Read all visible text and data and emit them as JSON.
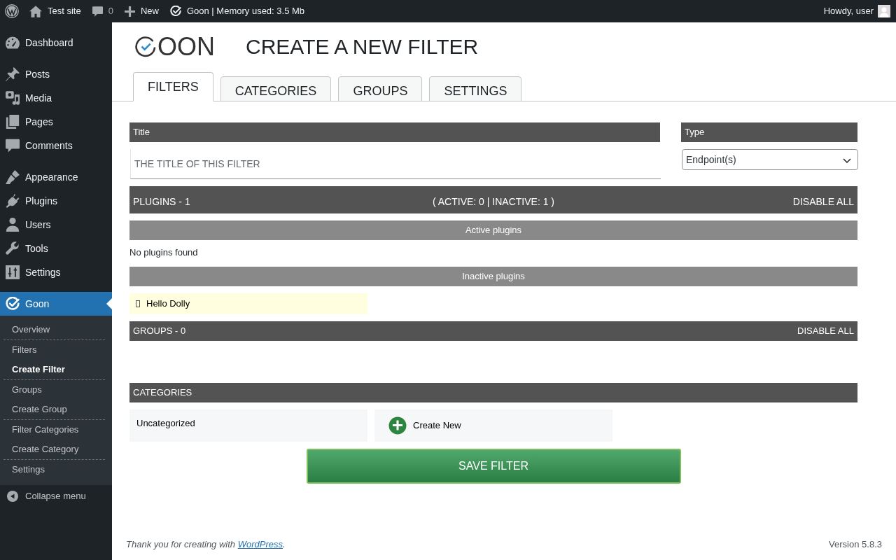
{
  "admin_bar": {
    "items": [
      {
        "kind": "home",
        "label": "Test site"
      },
      {
        "kind": "comments",
        "label": "0"
      },
      {
        "kind": "new",
        "label": "New"
      },
      {
        "kind": "goon",
        "label": "Goon | Memory used: 3.5 Mb"
      }
    ],
    "greeting": "Howdy, user"
  },
  "sidebar": {
    "menu_groups": [
      [
        {
          "kind": "dashboard",
          "label": "Dashboard",
          "selected": false
        }
      ],
      [
        {
          "kind": "posts",
          "label": "Posts",
          "selected": false
        },
        {
          "kind": "media",
          "label": "Media",
          "selected": false
        },
        {
          "kind": "pages",
          "label": "Pages",
          "selected": false
        },
        {
          "kind": "comments",
          "label": "Comments",
          "selected": false
        }
      ],
      [
        {
          "kind": "appearance",
          "label": "Appearance",
          "selected": false
        },
        {
          "kind": "plugins",
          "label": "Plugins",
          "selected": false
        },
        {
          "kind": "users",
          "label": "Users",
          "selected": false
        },
        {
          "kind": "tools",
          "label": "Tools",
          "selected": false
        },
        {
          "kind": "settings",
          "label": "Settings",
          "selected": false
        }
      ],
      [
        {
          "kind": "goon",
          "label": "Goon",
          "selected": true,
          "submenu_groups": [
            [
              {
                "label": "Overview",
                "selected": false
              }
            ],
            [
              {
                "label": "Filters",
                "selected": false
              },
              {
                "label": "Create Filter",
                "selected": true
              }
            ],
            [
              {
                "label": "Groups",
                "selected": false
              },
              {
                "label": "Create Group",
                "selected": false
              }
            ],
            [
              {
                "label": "Filter Categories",
                "selected": false
              },
              {
                "label": "Create Category",
                "selected": false
              }
            ],
            [
              {
                "label": "Settings",
                "selected": false
              }
            ]
          ]
        }
      ]
    ],
    "collapse_label": "Collapse menu"
  },
  "header": {
    "logo_text": "OON",
    "title": "CREATE A NEW FILTER"
  },
  "tabs": [
    {
      "label": "FILTERS",
      "selected": true
    },
    {
      "label": "CATEGORIES",
      "selected": false
    },
    {
      "label": "GROUPS",
      "selected": false
    },
    {
      "label": "SETTINGS",
      "selected": false
    }
  ],
  "form": {
    "title_field": {
      "label": "Title",
      "placeholder": "THE TITLE OF THIS FILTER"
    },
    "type_field": {
      "label": "Type",
      "value": "Endpoint(s)"
    }
  },
  "plugins": {
    "title": "PLUGINS - 1",
    "summary": "( ACTIVE: 0 | INACTIVE: 1 )",
    "action": "DISABLE ALL",
    "active_heading": "Active plugins",
    "active_empty": "No plugins found",
    "inactive_heading": "Inactive plugins",
    "inactive": [
      {
        "name": "Hello Dolly"
      }
    ]
  },
  "groups": {
    "title": "GROUPS - 0",
    "action": "DISABLE ALL"
  },
  "categories": {
    "title": "CATEGORIES",
    "items": [
      {
        "label": "Uncategorized"
      }
    ],
    "create_label": "Create New"
  },
  "save_button": "SAVE FILTER",
  "footer": {
    "text_before": "Thank you for creating with ",
    "link": "WordPress",
    "text_after": ".",
    "version": "Version 5.8.3"
  }
}
